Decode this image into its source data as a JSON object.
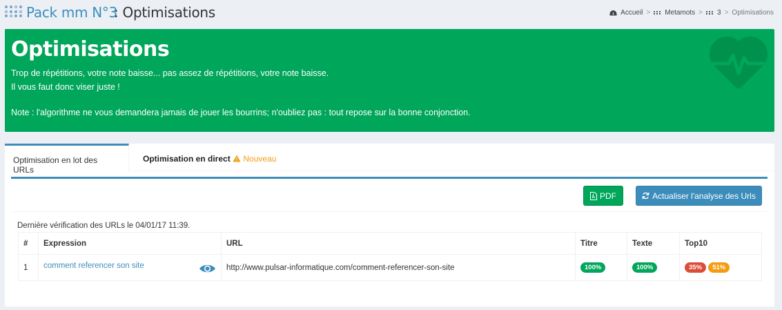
{
  "header": {
    "title_main": "Pack mm N°3",
    "title_sub": ": Optimisations",
    "breadcrumb": {
      "home": "Accueil",
      "metamots": "Metamots",
      "item": "3",
      "current": "Optimisations",
      "separator": ">"
    }
  },
  "callout": {
    "title": "Optimisations",
    "line1": "Trop de répétitions, votre note baisse... pas assez de répétitions, votre note baisse.",
    "line2": "Il vous faut donc viser juste !",
    "line3": "Note : l'algorithme ne vous demandera jamais de jouer les bourrins; n'oubliez pas : tout repose sur la bonne conjonction.",
    "icon": "heart-pulse-icon",
    "color": "#00a65a"
  },
  "tabs": {
    "batch": "Optimisation en lot des URLs",
    "direct": "Optimisation en direct",
    "direct_badge": "Nouveau"
  },
  "toolbar": {
    "pdf_label": "PDF",
    "refresh_label": "Actualiser l'analyse des Urls"
  },
  "verification": "Dernière vérification des URLs le 04/01/17 11:39.",
  "table": {
    "headers": {
      "num": "#",
      "expression": "Expression",
      "url": "URL",
      "titre": "Titre",
      "texte": "Texte",
      "top10": "Top10"
    },
    "rows": [
      {
        "num": "1",
        "expression": "comment referencer son site",
        "url": "http://www.pulsar-informatique.com/comment-referencer-son-site",
        "titre": "100%",
        "texte": "100%",
        "top10_a": "35%",
        "top10_b": "51%"
      }
    ]
  },
  "colors": {
    "accent": "#3c8dbc",
    "success": "#00a65a",
    "danger": "#dd4b39",
    "warning": "#f39c12"
  }
}
